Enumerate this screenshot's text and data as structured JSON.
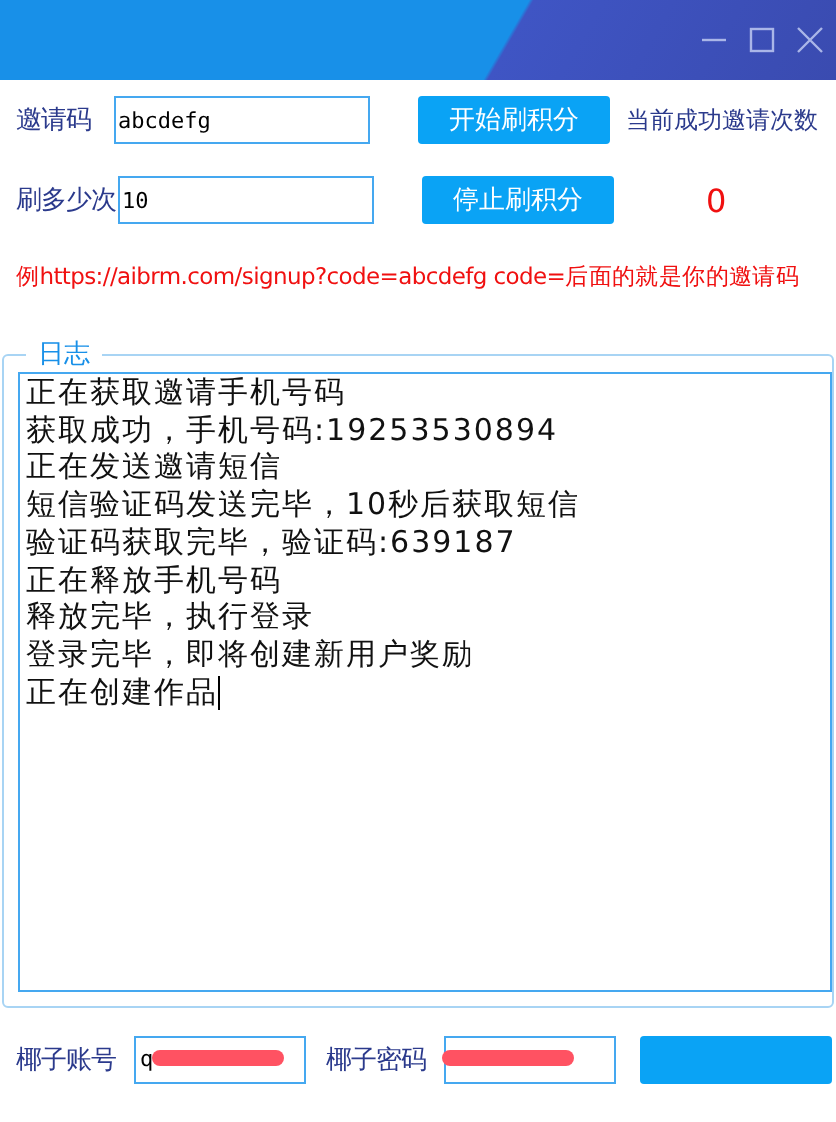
{
  "window": {
    "controls": [
      {
        "kind": "minimize"
      },
      {
        "kind": "maximize"
      },
      {
        "kind": "close"
      }
    ]
  },
  "invite": {
    "label": "邀请码",
    "value": "abcdefg"
  },
  "count": {
    "label": "刷多少次",
    "value": "10"
  },
  "buttons": [
    {
      "label": "开始刷积分"
    },
    {
      "label": "停止刷积分"
    }
  ],
  "success": {
    "label": "当前成功邀请次数",
    "value": "0"
  },
  "hint": "例https://aibrm.com/signup?code=abcdefg  code=后面的就是你的邀请码",
  "log": {
    "title": "日志",
    "lines": [
      "正在获取邀请手机号码",
      "获取成功，手机号码:19253530894",
      "正在发送邀请短信",
      "短信验证码发送完毕，10秒后获取短信",
      "验证码获取完毕，验证码:639187",
      "正在释放手机号码",
      "释放完毕，执行登录",
      "登录完毕，即将创建新用户奖励",
      "正在创建作品"
    ]
  },
  "account": {
    "label": "椰子账号",
    "value": "q",
    "redacted": true
  },
  "password": {
    "label": "椰子密码",
    "redacted": true
  }
}
